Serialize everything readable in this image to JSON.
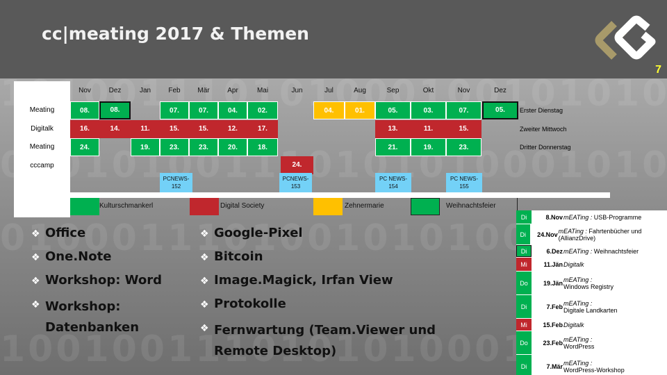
{
  "header": {
    "title": "cc|meating 2017  & Themen",
    "slide_number": "7",
    "logo_icon": "cc-logo-icon"
  },
  "calendar": {
    "months": [
      "Nov",
      "Dez",
      "Jan",
      "Feb",
      "Mär",
      "Apr",
      "Mai",
      "Jun",
      "Jul",
      "Aug",
      "Sep",
      "Okt",
      "Nov",
      "Dez"
    ],
    "row_labels": [
      "Meating",
      "Digitalk",
      "Meating",
      "cccamp"
    ],
    "rows": [
      {
        "name": "Meating",
        "description": "Erster Dienstag",
        "cells": [
          {
            "month": "Nov",
            "value": "08.",
            "color": "green"
          },
          {
            "month": "Dez",
            "value": "08.",
            "color": "green",
            "highlighted": true
          },
          {
            "month": "Feb",
            "value": "07.",
            "color": "green"
          },
          {
            "month": "Mär",
            "value": "07.",
            "color": "green"
          },
          {
            "month": "Apr",
            "value": "04.",
            "color": "green"
          },
          {
            "month": "Mai",
            "value": "02.",
            "color": "green"
          },
          {
            "month": "Jul",
            "value": "04.",
            "color": "yellow"
          },
          {
            "month": "Aug",
            "value": "01.",
            "color": "yellow"
          },
          {
            "month": "Sep",
            "value": "05.",
            "color": "green"
          },
          {
            "month": "Okt",
            "value": "03.",
            "color": "green"
          },
          {
            "month": "Nov",
            "value": "07.",
            "color": "green"
          },
          {
            "month": "Dez",
            "value": "05.",
            "color": "green",
            "highlighted": true
          }
        ]
      },
      {
        "name": "Digitalk",
        "description": "Zweiter Mittwoch",
        "cells": [
          {
            "month": "Nov",
            "value": "16.",
            "color": "red"
          },
          {
            "month": "Dez",
            "value": "14.",
            "color": "red"
          },
          {
            "month": "Jan",
            "value": "11.",
            "color": "red"
          },
          {
            "month": "Feb",
            "value": "15.",
            "color": "red"
          },
          {
            "month": "Mär",
            "value": "15.",
            "color": "red"
          },
          {
            "month": "Apr",
            "value": "12.",
            "color": "red"
          },
          {
            "month": "Mai",
            "value": "17.",
            "color": "red"
          },
          {
            "month": "Sep",
            "value": "13.",
            "color": "red"
          },
          {
            "month": "Okt",
            "value": "11.",
            "color": "red"
          },
          {
            "month": "Nov",
            "value": "15.",
            "color": "red"
          }
        ]
      },
      {
        "name": "Meating",
        "description": "Dritter Donnerstag",
        "cells": [
          {
            "month": "Nov",
            "value": "24.",
            "color": "green"
          },
          {
            "month": "Jan",
            "value": "19.",
            "color": "green"
          },
          {
            "month": "Feb",
            "value": "23.",
            "color": "green"
          },
          {
            "month": "Mär",
            "value": "23.",
            "color": "green"
          },
          {
            "month": "Apr",
            "value": "20.",
            "color": "green"
          },
          {
            "month": "Mai",
            "value": "18.",
            "color": "green"
          },
          {
            "month": "Sep",
            "value": "21.",
            "color": "green"
          },
          {
            "month": "Okt",
            "value": "19.",
            "color": "green"
          },
          {
            "month": "Nov",
            "value": "23.",
            "color": "green"
          }
        ]
      },
      {
        "name": "cccamp",
        "description": "",
        "cells": [
          {
            "month": "Jun",
            "value": "24.",
            "color": "red"
          }
        ]
      }
    ],
    "pcnews": [
      {
        "label": "PCNEWS-152",
        "month": "Feb"
      },
      {
        "label": "PCNEWS-153",
        "month": "Jun"
      },
      {
        "label": "PCNEWS-154",
        "month": "Sep"
      },
      {
        "label": "PCNEWS-155",
        "month": "Nov"
      }
    ],
    "pcnews_lines": [
      [
        "PCNEWS-",
        "152"
      ],
      [
        "PCNEWS-",
        "153"
      ],
      [
        "PC NEWS-",
        "154"
      ],
      [
        "PC NEWS-",
        "155"
      ]
    ],
    "legend": [
      {
        "label": "Kulturschmankerl",
        "color": "#00b050"
      },
      {
        "label": "Digital Society",
        "color": "#c0272d"
      },
      {
        "label": "Zehnermarie",
        "color": "#ffc000"
      },
      {
        "label": "Weihnachtsfeier",
        "color": "#00b050"
      }
    ]
  },
  "topics_left": [
    "Office",
    "One.Note",
    "Workshop: Word",
    "Workshop:",
    "Datenbanken"
  ],
  "topics_right": [
    "Google-Pixel",
    "Bitcoin",
    "Image.Magick, Irfan View",
    "Protokolle",
    "Fernwartung (Team.Viewer und",
    "Remote Desktop)"
  ],
  "schedule": [
    {
      "weekday": "Di",
      "color": "green",
      "date": "8.Nov",
      "kind": "mEATing",
      "topic": "USB-Programme"
    },
    {
      "weekday": "Di",
      "color": "green",
      "date": "24.Nov",
      "kind": "mEATing",
      "topic": "Fahrtenbücher und (AllianzDrive)"
    },
    {
      "weekday": "Di",
      "color": "green",
      "date": "6.Dez",
      "kind": "mEATing",
      "topic": "Weihnachtsfeier",
      "highlighted": true
    },
    {
      "weekday": "Mi",
      "color": "red",
      "date": "11.Jän",
      "kind": "Digitalk",
      "topic": ""
    },
    {
      "weekday": "Do",
      "color": "green",
      "date": "19.Jän",
      "kind": "mEATing",
      "topic": "Windows Registry"
    },
    {
      "weekday": "Di",
      "color": "green",
      "date": "7.Feb",
      "kind": "mEATing",
      "topic": "Digitale Landkarten"
    },
    {
      "weekday": "Mi",
      "color": "red",
      "date": "15.Feb",
      "kind": "Digitalk",
      "topic": ""
    },
    {
      "weekday": "Do",
      "color": "green",
      "date": "23.Feb",
      "kind": "mEATing",
      "topic": "WordPress"
    },
    {
      "weekday": "Di",
      "color": "green",
      "date": "7.Mär",
      "kind": "mEATing",
      "topic": "WordPress-Workshop"
    }
  ],
  "background_binary": [
    "1010011101010001001010100101",
    "00010100111010101000101010100",
    "0100011101001010100001010",
    "1001001110101010001010100010"
  ]
}
